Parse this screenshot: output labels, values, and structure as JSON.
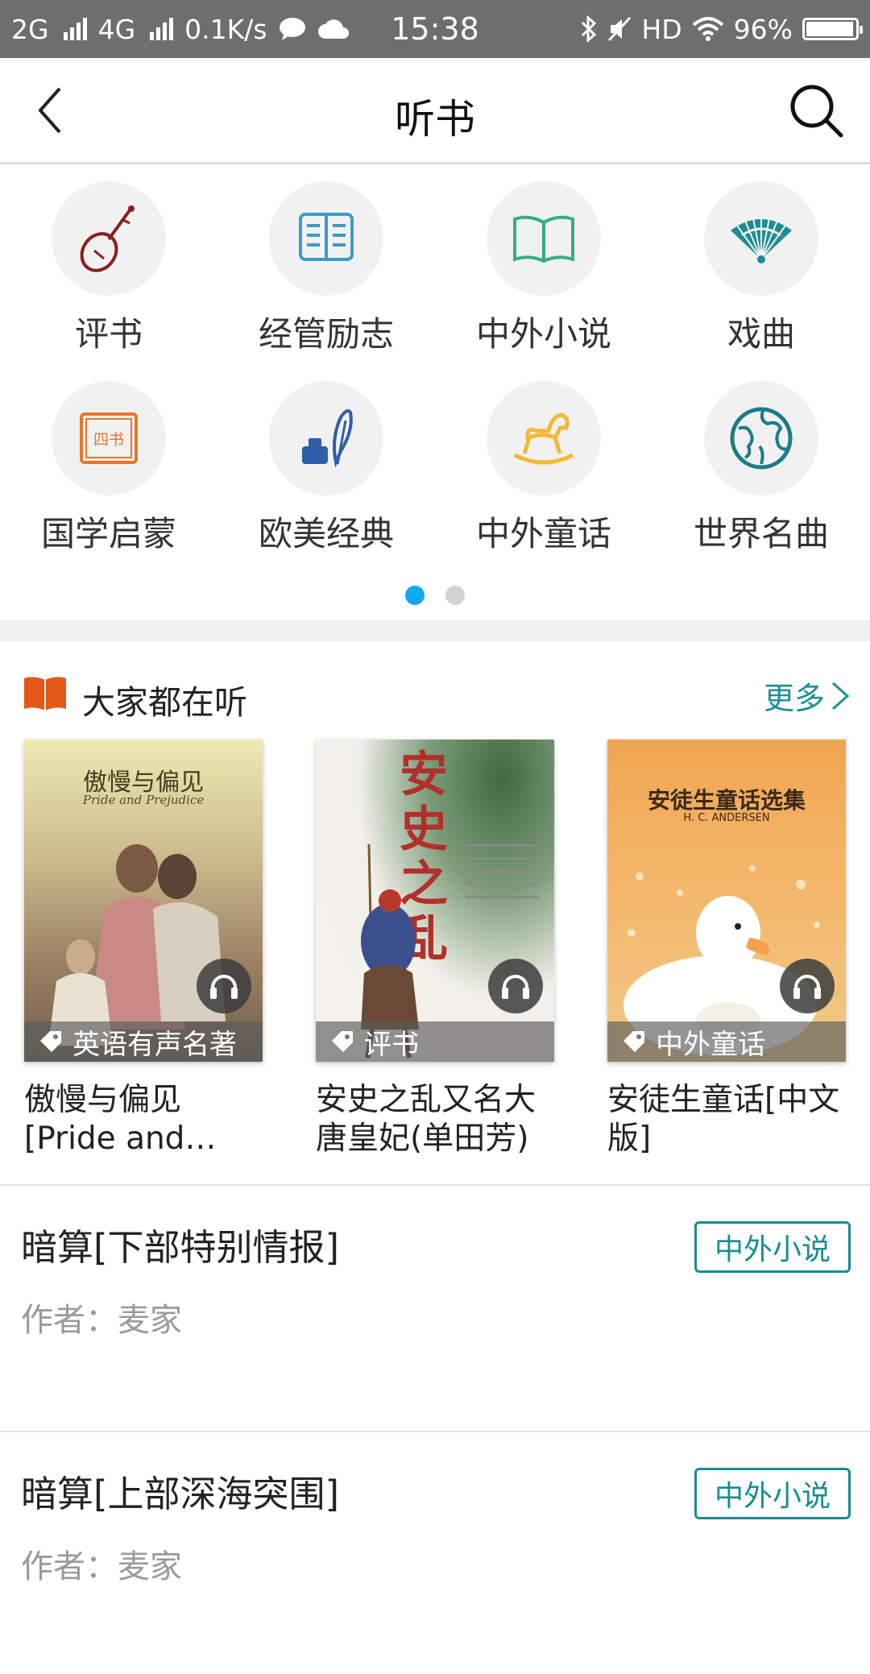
{
  "status_bar": {
    "network_1": "2G",
    "network_2": "4G",
    "speed": "0.1K/s",
    "time": "15:38",
    "hd": "HD",
    "battery": "96%",
    "battery_level": 0.96
  },
  "header": {
    "title": "听书"
  },
  "categories": [
    {
      "label": "评书",
      "icon": "pipa-icon",
      "color": "#8b1e1e"
    },
    {
      "label": "经管励志",
      "icon": "open-book-icon",
      "color": "#3a9dc2"
    },
    {
      "label": "中外小说",
      "icon": "book-outline-icon",
      "color": "#34b07a"
    },
    {
      "label": "戏曲",
      "icon": "fan-icon",
      "color": "#1d8c96"
    },
    {
      "label": "国学启蒙",
      "icon": "scroll-icon",
      "icon_text": "四书",
      "color": "#e8762a"
    },
    {
      "label": "欧美经典",
      "icon": "ink-quill-icon",
      "color": "#2f5fa8"
    },
    {
      "label": "中外童话",
      "icon": "rocking-horse-icon",
      "color": "#f2b937"
    },
    {
      "label": "世界名曲",
      "icon": "globe-icon",
      "color": "#1b7d85"
    }
  ],
  "pager": {
    "active": 0,
    "count": 2
  },
  "popular": {
    "title": "大家都在听",
    "more": "更多",
    "books": [
      {
        "title": "傲慢与偏见[Pride and…",
        "tag": "英语有声名著",
        "cover_title": "傲慢与偏见",
        "cover_subtitle": "Pride and Prejudice"
      },
      {
        "title": "安史之乱又名大唐皇妃(单田芳)",
        "tag": "评书",
        "cover_title": "安史之乱",
        "cover_subtitle": ""
      },
      {
        "title": "安徒生童话[中文版]",
        "tag": "中外童话",
        "cover_title": "安徒生童话选集",
        "cover_subtitle": "H. C. ANDERSEN"
      }
    ]
  },
  "list": [
    {
      "title": "暗算[下部特别情报]",
      "badge": "中外小说",
      "author": "作者：麦家"
    },
    {
      "title": "暗算[上部深海突围]",
      "badge": "中外小说",
      "author": "作者：麦家"
    }
  ],
  "colors": {
    "accent": "#12a7f2",
    "teal": "#178d92",
    "section_icon": "#e4581a"
  }
}
